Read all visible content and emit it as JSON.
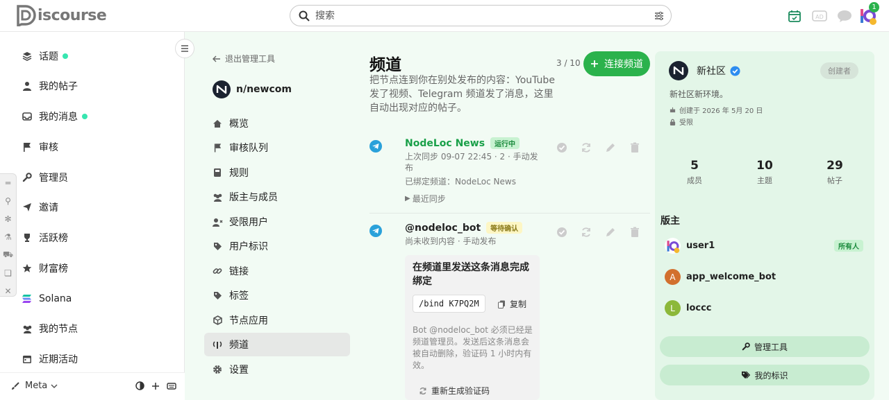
{
  "header": {
    "logo_text": "iscourse",
    "search_placeholder": "搜索",
    "notification_count": "1",
    "accent": "#2bb24c"
  },
  "sidebar": {
    "items": [
      {
        "label": "话题",
        "icon": "layer-icon",
        "dot": true
      },
      {
        "label": "我的帖子",
        "icon": "user-icon",
        "dot": false
      },
      {
        "label": "我的消息",
        "icon": "inbox-icon",
        "dot": true
      },
      {
        "label": "审核",
        "icon": "flag-icon",
        "dot": false
      },
      {
        "label": "管理员",
        "icon": "wrench-icon",
        "dot": false
      },
      {
        "label": "邀请",
        "icon": "paper-plane-icon",
        "dot": false
      },
      {
        "label": "活跃榜",
        "icon": "trophy-icon",
        "dot": false
      },
      {
        "label": "财富榜",
        "icon": "star-icon",
        "dot": false
      },
      {
        "label": "Solana",
        "icon": "solana-icon",
        "dot": false
      },
      {
        "label": "我的节点",
        "icon": "users-icon",
        "dot": false
      },
      {
        "label": "近期活动",
        "icon": "calendar-icon",
        "dot": false
      }
    ],
    "bottom_label": "Meta"
  },
  "adminnav": {
    "back_label": "退出管理工具",
    "community_name": "n/newcom",
    "items": [
      {
        "label": "概览",
        "icon": "home-icon"
      },
      {
        "label": "审核队列",
        "icon": "flag-icon"
      },
      {
        "label": "规则",
        "icon": "book-icon"
      },
      {
        "label": "版主与成员",
        "icon": "users-icon"
      },
      {
        "label": "受限用户",
        "icon": "user-x-icon"
      },
      {
        "label": "用户标识",
        "icon": "tag-icon"
      },
      {
        "label": "链接",
        "icon": "link-icon"
      },
      {
        "label": "标签",
        "icon": "tag-icon"
      },
      {
        "label": "节点应用",
        "icon": "cube-icon"
      },
      {
        "label": "频道",
        "icon": "antenna-icon",
        "active": true
      },
      {
        "label": "设置",
        "icon": "gear-icon"
      }
    ]
  },
  "main": {
    "title": "频道",
    "count": "3 / 10",
    "connect_label": "连接频道",
    "description": "把节点连到你在别处发布的内容：YouTube 发了视频、Telegram 频道发了消息，这里自动出现对应的帖子。",
    "channels": [
      {
        "name": "NodeLoc News",
        "status": "运行中",
        "line1": "上次同步 09-07 22:45 · 2 · 手动发布",
        "line2": "已绑定频道：NodeLoc News",
        "recent_sync": "最近同步"
      },
      {
        "name": "@nodeloc_bot",
        "status": "等待确认",
        "line1": "尚未收到内容 · 手动发布",
        "bind_title": "在频道里发送这条消息完成绑定",
        "bind_code": "/bind K7PQ2M",
        "copy_label": "复制",
        "bind_desc": "Bot @nodeloc_bot 必须已经是频道管理员。发送后这条消息会被自动删除，验证码 1 小时内有效。",
        "regen_label": "重新生成验证码"
      }
    ]
  },
  "right": {
    "name": "新社区",
    "creator_label": "创建者",
    "desc": "新社区新环境。",
    "created": "创建于 2026 年 5月 20 日",
    "restricted": "受限",
    "stats": [
      {
        "n": "5",
        "l": "成员"
      },
      {
        "n": "10",
        "l": "主题"
      },
      {
        "n": "29",
        "l": "帖子"
      }
    ],
    "mod_title": "版主",
    "mods": [
      {
        "name": "user1",
        "avatar": "",
        "color": "#ffffff"
      },
      {
        "name": "app_welcome_bot",
        "avatar": "A",
        "color": "#d2702e"
      },
      {
        "name": "loccc",
        "avatar": "L",
        "color": "#8cb83a"
      }
    ],
    "owner_label": "所有人",
    "admin_tools_label": "管理工具",
    "my_tags_label": "我的标识"
  }
}
